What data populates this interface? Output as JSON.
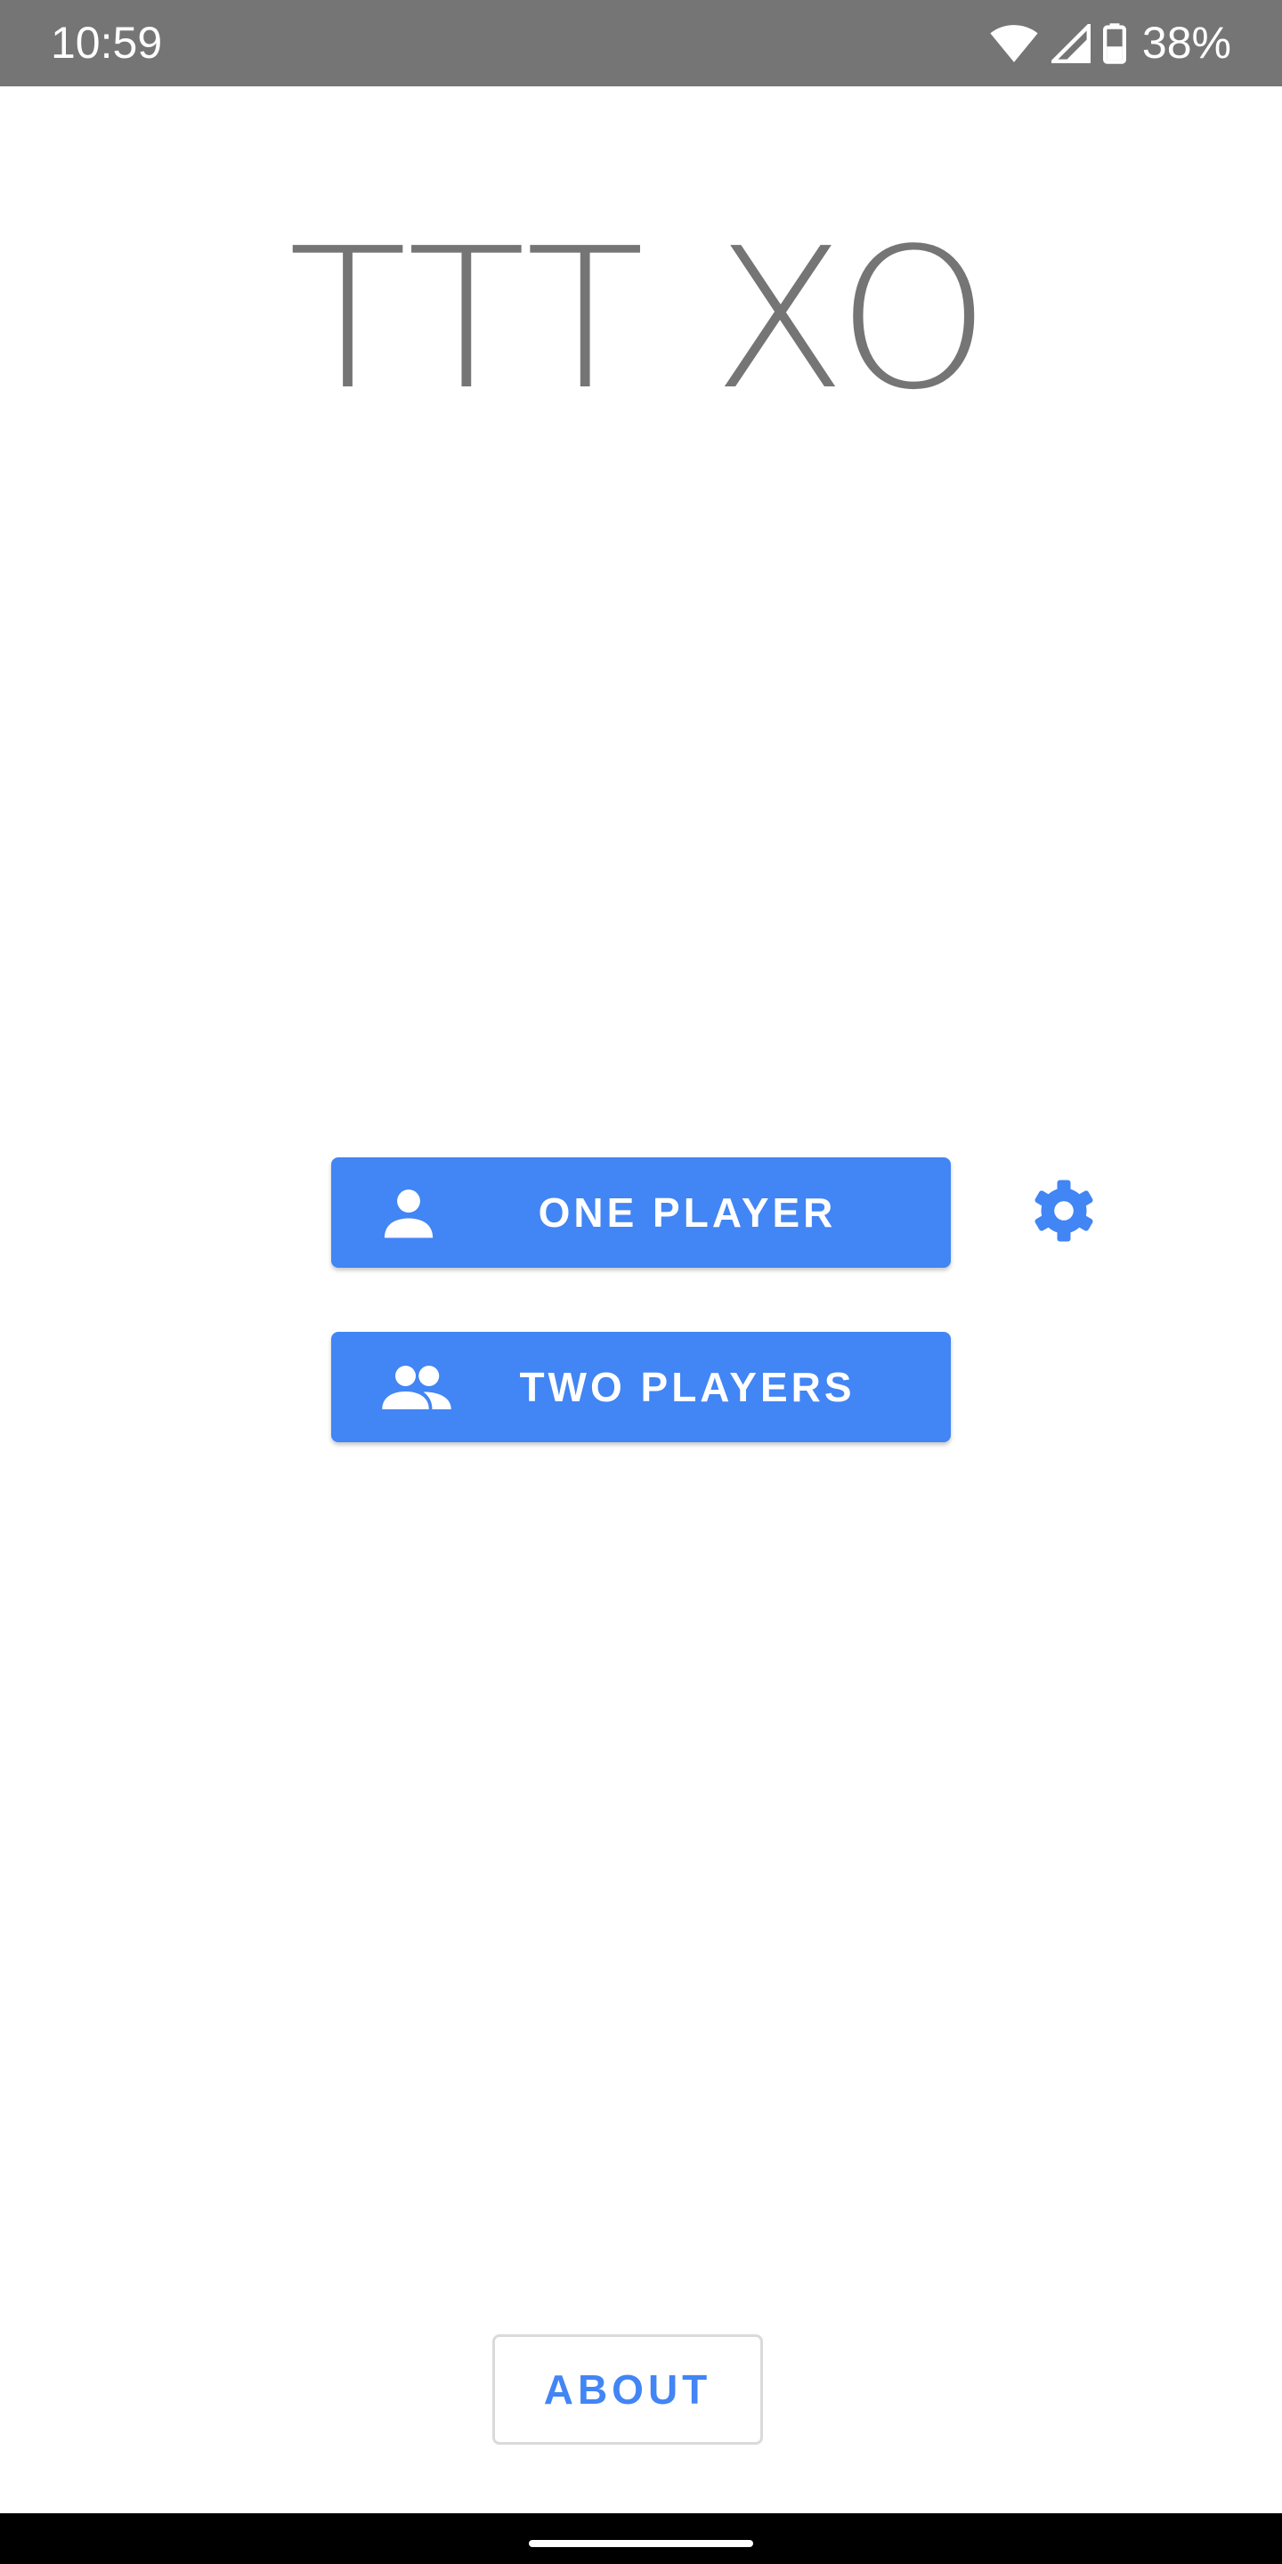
{
  "status_bar": {
    "time": "10:59",
    "battery": "38%",
    "icons": [
      "wifi-icon",
      "cell-signal-icon",
      "battery-icon"
    ]
  },
  "app": {
    "title": "TTT XO"
  },
  "menu": {
    "one_player_label": "ONE PLAYER",
    "two_players_label": "TWO PLAYERS",
    "about_label": "ABOUT",
    "one_player_icon": "person-icon",
    "two_players_icon": "people-icon",
    "settings_icon": "gear-icon"
  },
  "colors": {
    "accent": "#4285f4",
    "status_bar": "#757575",
    "title": "#757575",
    "background": "#ffffff",
    "nav_bar": "#000000"
  }
}
